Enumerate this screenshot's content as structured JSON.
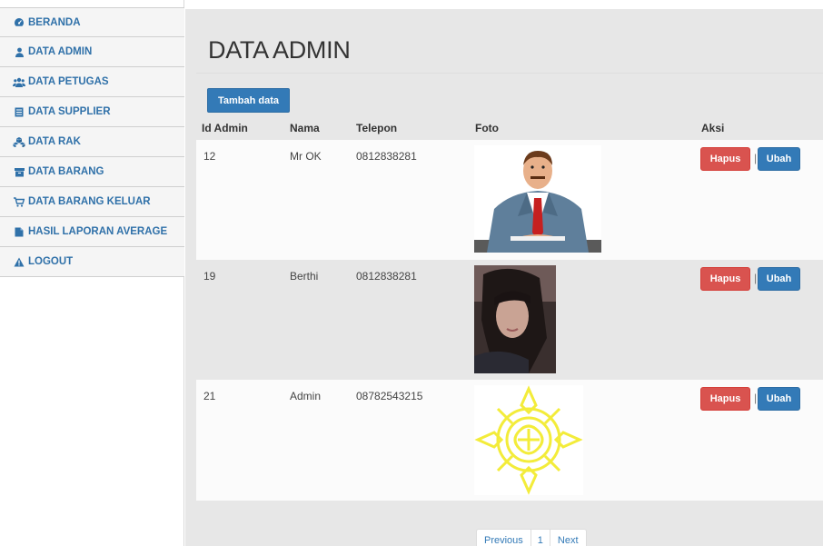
{
  "sidebar": {
    "items": [
      {
        "label": "BERANDA",
        "icon": "dashboard-icon"
      },
      {
        "label": "DATA ADMIN",
        "icon": "user-icon"
      },
      {
        "label": "DATA PETUGAS",
        "icon": "users-icon"
      },
      {
        "label": "DATA SUPPLIER",
        "icon": "list-icon"
      },
      {
        "label": "DATA RAK",
        "icon": "cubes-icon"
      },
      {
        "label": "DATA BARANG",
        "icon": "box-icon"
      },
      {
        "label": "DATA BARANG KELUAR",
        "icon": "cart-icon"
      },
      {
        "label": "HASIL LAPORAN AVERAGE",
        "icon": "file-icon"
      },
      {
        "label": "LOGOUT",
        "icon": "warning-icon"
      }
    ]
  },
  "main": {
    "title": "DATA ADMIN",
    "add_button": "Tambah data",
    "columns": [
      "Id Admin",
      "Nama",
      "Telepon",
      "Foto",
      "Aksi"
    ],
    "rows": [
      {
        "id": "12",
        "nama": "Mr OK",
        "telepon": "0812838281",
        "foto": "businessman-cartoon-photo"
      },
      {
        "id": "19",
        "nama": "Berthi",
        "telepon": "0812838281",
        "foto": "woman-portrait-photo"
      },
      {
        "id": "21",
        "nama": "Admin",
        "telepon": "08782543215",
        "foto": "yellow-emblem-photo"
      }
    ],
    "actions": {
      "delete": "Hapus",
      "separator": "|",
      "edit": "Ubah"
    }
  },
  "pagination": {
    "previous": "Previous",
    "page": "1",
    "next": "Next"
  },
  "colors": {
    "primary": "#337ab7",
    "danger": "#d9534f",
    "link": "#3071a9"
  }
}
